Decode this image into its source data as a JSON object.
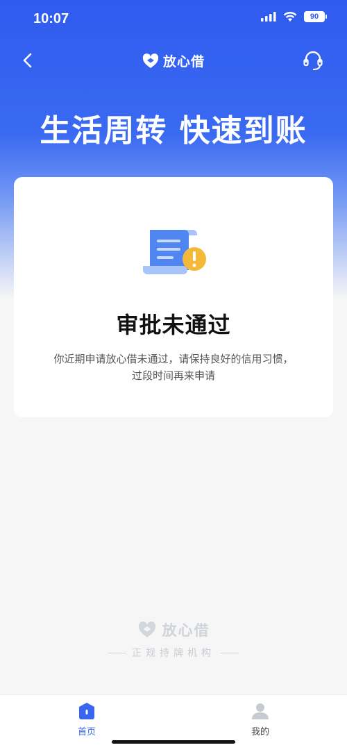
{
  "status_bar": {
    "time": "10:07",
    "battery": "90"
  },
  "nav": {
    "brand": "放心借",
    "back_icon": "chevron-left-icon",
    "support_icon": "headset-icon"
  },
  "slogan": "生活周转 快速到账",
  "result_card": {
    "icon": "document-warning-icon",
    "title": "审批未通过",
    "description_line1": "你近期申请放心借未通过，请保持良好的信用习惯，",
    "description_line2": "过段时间再来申请"
  },
  "footer": {
    "brand": "放心借",
    "tagline": "正规持牌机构"
  },
  "tabbar": {
    "tabs": [
      {
        "label": "首页",
        "icon": "home-icon",
        "active": true
      },
      {
        "label": "我的",
        "icon": "user-icon",
        "active": false
      }
    ]
  },
  "colors": {
    "accent": "#3866ef",
    "warning": "#f5b93a"
  }
}
